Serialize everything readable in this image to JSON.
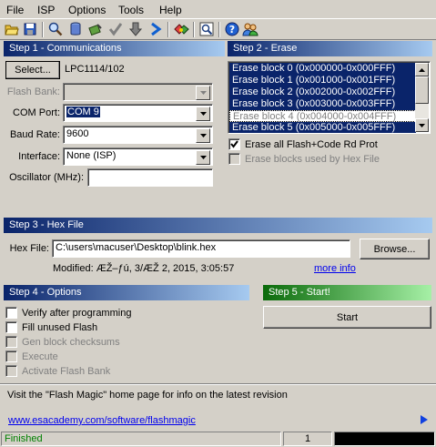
{
  "menu": [
    {
      "label": "File"
    },
    {
      "label": "ISP"
    },
    {
      "label": "Options"
    },
    {
      "label": "Tools"
    },
    {
      "label": "Help"
    }
  ],
  "step1": {
    "header": "Step 1 - Communications",
    "select_label": "Select...",
    "device": "LPC1114/102",
    "flash_bank_label": "Flash Bank:",
    "flash_bank_value": "",
    "com_port_label": "COM Port:",
    "com_port_value": "COM 9",
    "baud_label": "Baud Rate:",
    "baud_value": "9600",
    "interface_label": "Interface:",
    "interface_value": "None (ISP)",
    "osc_label": "Oscillator (MHz):",
    "osc_value": ""
  },
  "step2": {
    "header": "Step 2 - Erase",
    "blocks": [
      "Erase block 0 (0x000000-0x000FFF)",
      "Erase block 1 (0x001000-0x001FFF)",
      "Erase block 2 (0x002000-0x002FFF)",
      "Erase block 3 (0x003000-0x003FFF)",
      "Erase block 4 (0x004000-0x004FFF)",
      "Erase block 5 (0x005000-0x005FFF)"
    ],
    "erase_all_label": "Erase all Flash+Code Rd Prot",
    "erase_hex_label": "Erase blocks used by Hex File"
  },
  "step3": {
    "header": "Step 3 - Hex File",
    "hex_label": "Hex File:",
    "hex_value": "C:\\users\\macuser\\Desktop\\blink.hex",
    "browse_label": "Browse...",
    "modified_text": "Modified: ÆŽ–ƒú, 3/ÆŽ 2, 2015, 3:05:57",
    "more_info": "more info"
  },
  "step4": {
    "header": "Step 4 - Options",
    "options": [
      {
        "label": "Verify after programming",
        "enabled": true
      },
      {
        "label": "Fill unused Flash",
        "enabled": true
      },
      {
        "label": "Gen block checksums",
        "enabled": false
      },
      {
        "label": "Execute",
        "enabled": false
      },
      {
        "label": "Activate Flash Bank",
        "enabled": false
      }
    ]
  },
  "step5": {
    "header": "Step 5 - Start!",
    "start_label": "Start"
  },
  "info": {
    "text": "Visit the \"Flash Magic\" home page for info on the latest revision",
    "url": "www.esacademy.com/software/flashmagic"
  },
  "status": {
    "text": "Finished",
    "count": "1"
  },
  "icons": [
    "open-icon",
    "save-icon",
    "search-icon",
    "erase-icon",
    "program-icon",
    "verify-icon",
    "download-icon",
    "go-icon",
    "hex-icon",
    "find-icon",
    "help-icon",
    "users-icon"
  ]
}
